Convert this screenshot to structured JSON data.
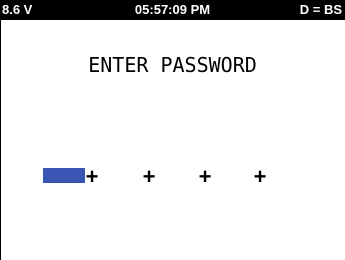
{
  "status_bar": {
    "battery": "8.6 V",
    "time": "05:57:09 PM",
    "mode": "D = BS"
  },
  "title": "ENTER PASSWORD",
  "password": {
    "slots": [
      "+",
      "+",
      "+",
      "+"
    ],
    "cursor_color": "#3a56b4"
  }
}
